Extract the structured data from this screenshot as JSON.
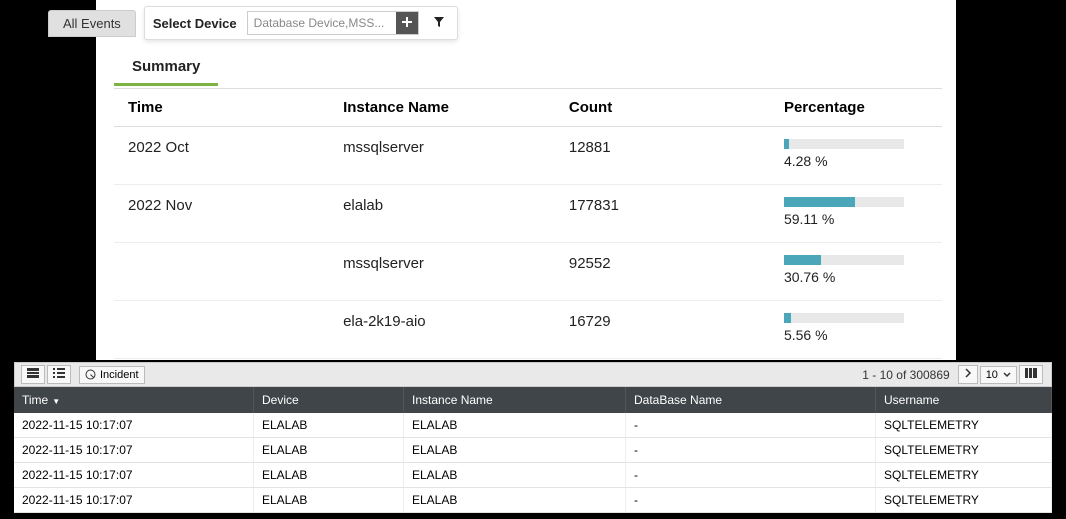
{
  "tabs": {
    "all_events": "All Events",
    "select_device_label": "Select Device",
    "device_input_value": "Database Device,MSS..."
  },
  "summary": {
    "tab_label": "Summary",
    "columns": {
      "time": "Time",
      "instance": "Instance Name",
      "count": "Count",
      "percentage": "Percentage"
    },
    "rows": [
      {
        "time": "2022 Oct",
        "instance": "mssqlserver",
        "count": "12881",
        "pct": "4.28 %",
        "bar": 4.28
      },
      {
        "time": "2022 Nov",
        "instance": "elalab",
        "count": "177831",
        "pct": "59.11 %",
        "bar": 59.11
      },
      {
        "time": "",
        "instance": "mssqlserver",
        "count": "92552",
        "pct": "30.76 %",
        "bar": 30.76
      },
      {
        "time": "",
        "instance": "ela-2k19-aio",
        "count": "16729",
        "pct": "5.56 %",
        "bar": 5.56
      }
    ]
  },
  "grid": {
    "incident_label": "Incident",
    "pager": "1 - 10 of 300869",
    "page_size": "10",
    "columns": {
      "time": "Time",
      "device": "Device",
      "instance": "Instance Name",
      "db": "DataBase Name",
      "user": "Username"
    },
    "rows": [
      {
        "time": "2022-11-15 10:17:07",
        "device": "ELALAB",
        "instance": "ELALAB",
        "db": "-",
        "user": "SQLTELEMETRY"
      },
      {
        "time": "2022-11-15 10:17:07",
        "device": "ELALAB",
        "instance": "ELALAB",
        "db": "-",
        "user": "SQLTELEMETRY"
      },
      {
        "time": "2022-11-15 10:17:07",
        "device": "ELALAB",
        "instance": "ELALAB",
        "db": "-",
        "user": "SQLTELEMETRY"
      },
      {
        "time": "2022-11-15 10:17:07",
        "device": "ELALAB",
        "instance": "ELALAB",
        "db": "-",
        "user": "SQLTELEMETRY"
      }
    ]
  }
}
